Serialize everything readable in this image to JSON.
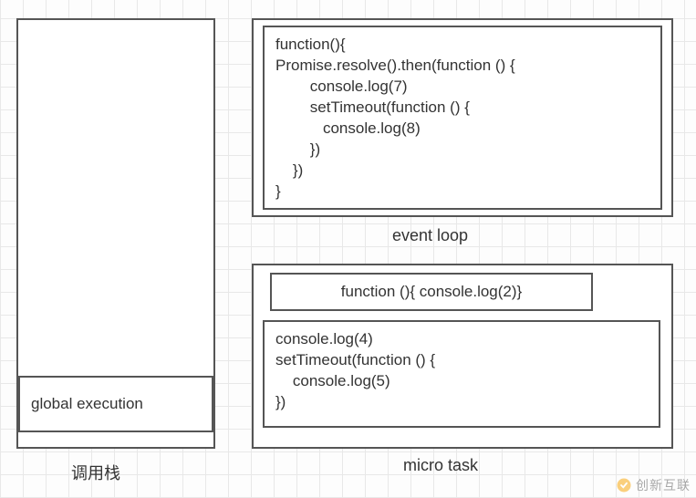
{
  "callstack": {
    "global_execution_label": "global execution",
    "caption": "调用栈"
  },
  "eventloop": {
    "caption": "event loop",
    "code": "function(){\nPromise.resolve().then(function () {\n        console.log(7)\n        setTimeout(function () {\n           console.log(8)\n        })\n    })\n}"
  },
  "microtask": {
    "caption": "micro task",
    "item1_code": "function (){ console.log(2)}",
    "item2_code": "console.log(4)\nsetTimeout(function () {\n    console.log(5)\n})"
  },
  "watermark": {
    "text": "创新互联"
  }
}
